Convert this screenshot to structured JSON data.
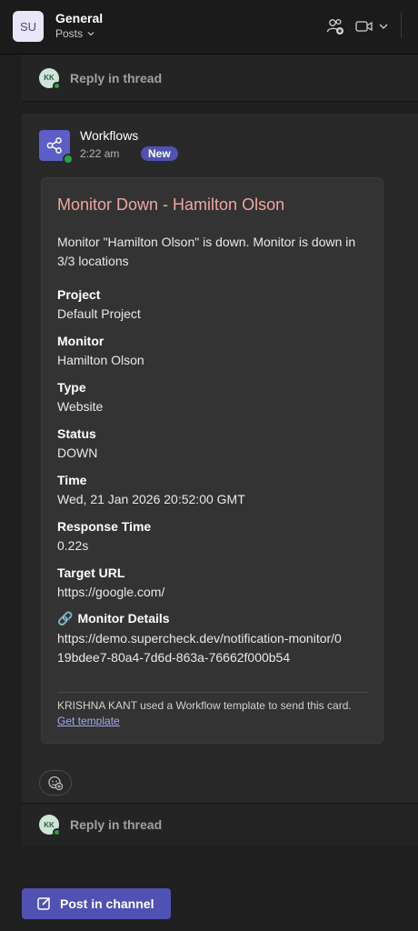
{
  "header": {
    "avatar_initials": "SU",
    "channel_title": "General",
    "channel_tab": "Posts"
  },
  "reply_top": {
    "avatar_initials": "KK",
    "label": "Reply in thread"
  },
  "post": {
    "author": "Workflows",
    "time": "2:22 am",
    "badge": "New",
    "card": {
      "title": "Monitor Down - Hamilton Olson",
      "description": "Monitor \"Hamilton Olson\" is down. Monitor is down in 3/3 locations",
      "fields": [
        {
          "label": "Project",
          "value": "Default Project"
        },
        {
          "label": "Monitor",
          "value": "Hamilton Olson"
        },
        {
          "label": "Type",
          "value": "Website"
        },
        {
          "label": "Status",
          "value": "DOWN"
        },
        {
          "label": "Time",
          "value": "Wed, 21 Jan 2026 20:52:00 GMT"
        },
        {
          "label": "Response Time",
          "value": "0.22s"
        },
        {
          "label": "Target URL",
          "value": "https://google.com/"
        },
        {
          "label": "Monitor Details",
          "value": "https://demo.supercheck.dev/notification-monitor/019bdee7-80a4-7d6d-863a-76662f000b54"
        }
      ],
      "details_icon": "🔗",
      "footer_text": "KRISHNA KANT used a Workflow template to send this card.",
      "footer_link": "Get template"
    }
  },
  "reply_bottom": {
    "avatar_initials": "KK",
    "label": "Reply in thread"
  },
  "post_button": {
    "label": "Post in channel"
  },
  "colors": {
    "accent": "#5b5fc7",
    "badge": "#4f52b2",
    "card_title": "#f0a5a0",
    "presence": "#2ea043"
  }
}
